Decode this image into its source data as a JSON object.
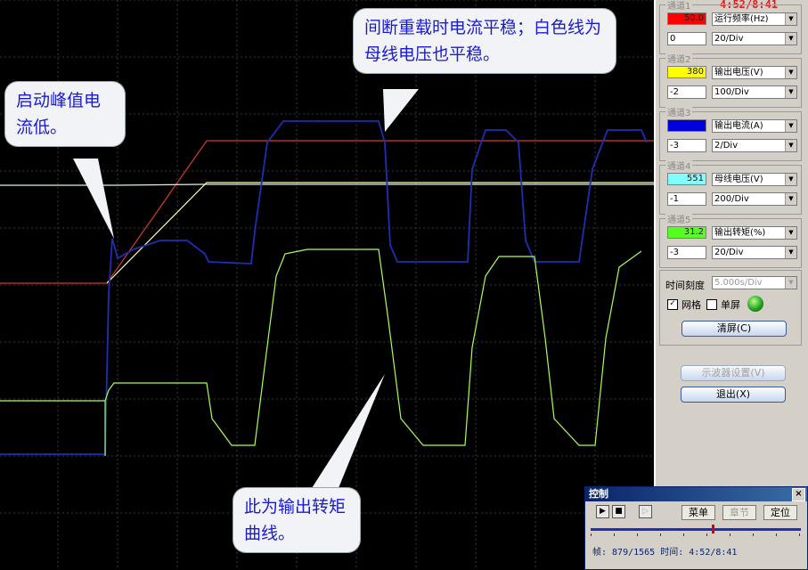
{
  "header": {
    "time": "4:52/8:41"
  },
  "channels": [
    {
      "title": "通道1",
      "swatch_color": "#ff0000",
      "value": "50.0",
      "measure": "运行频率(Hz)",
      "offset": "0",
      "scale": "20/Div"
    },
    {
      "title": "通道2",
      "swatch_color": "#ffff00",
      "value": "380",
      "measure": "输出电压(V)",
      "offset": "-2",
      "scale": "100/Div"
    },
    {
      "title": "通道3",
      "swatch_color": "#0000dd",
      "value": "",
      "measure": "输出电流(A)",
      "offset": "-3",
      "scale": "2/Div"
    },
    {
      "title": "通道4",
      "swatch_color": "#80ffff",
      "value": "551",
      "measure": "母线电压(V)",
      "offset": "-1",
      "scale": "200/Div"
    },
    {
      "title": "通道5",
      "swatch_color": "#55ff22",
      "value": "31.2",
      "measure": "输出转矩(%)",
      "offset": "-3",
      "scale": "20/Div"
    }
  ],
  "time_scale": {
    "label": "时间刻度",
    "value": "5.000s/Div"
  },
  "options": {
    "grid_label": "网格",
    "single_label": "单屏"
  },
  "buttons": {
    "clear": "清屏(C)",
    "display": "示波器设置(V)",
    "exit": "退出(X)"
  },
  "control": {
    "title": "控制",
    "close": "×",
    "menu": "菜单",
    "chapter": "章节",
    "locate": "定位",
    "status": "帧: 879/1565 时间: 4:52/8:41"
  },
  "callouts": {
    "top": "间断重载时电流平稳；白色线为母线电压也平稳。",
    "left": "启动峰值电流低。",
    "bottom": "此为输出转矩曲线。"
  }
}
